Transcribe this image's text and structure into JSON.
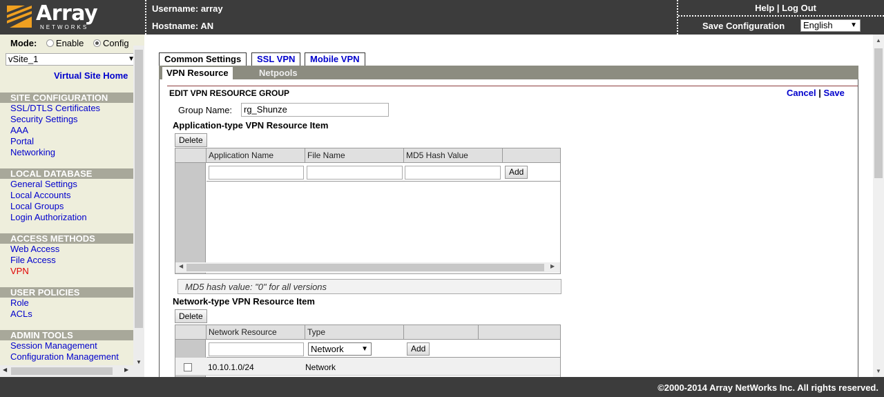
{
  "header": {
    "logo_text": "Array",
    "logo_subtext": "NETWORKS",
    "username_label": "Username:",
    "username": "array",
    "hostname_label": "Hostname:",
    "hostname": "AN",
    "help_label": "Help",
    "separator": "|",
    "logout_label": "Log Out",
    "save_config_label": "Save Configuration",
    "language": "English"
  },
  "sidebar": {
    "mode_label": "Mode:",
    "mode_enable": "Enable",
    "mode_config": "Config",
    "vsite": "vSite_1",
    "vsite_home": "Virtual Site Home",
    "sections": [
      {
        "title": "SITE CONFIGURATION",
        "items": [
          "SSL/DTLS Certificates",
          "Security Settings",
          "AAA",
          "Portal",
          "Networking"
        ]
      },
      {
        "title": "LOCAL DATABASE",
        "items": [
          "General Settings",
          "Local Accounts",
          "Local Groups",
          "Login Authorization"
        ]
      },
      {
        "title": "ACCESS METHODS",
        "items": [
          "Web Access",
          "File Access",
          "VPN"
        ]
      },
      {
        "title": "USER POLICIES",
        "items": [
          "Role",
          "ACLs"
        ]
      },
      {
        "title": "ADMIN TOOLS",
        "items": [
          "Session Management",
          "Configuration Management"
        ]
      }
    ],
    "active_item": "VPN"
  },
  "tabs": {
    "primary": [
      "Common Settings",
      "SSL VPN",
      "Mobile VPN"
    ],
    "secondary": [
      "VPN Resource",
      "Netpools"
    ]
  },
  "edit": {
    "title": "EDIT VPN RESOURCE GROUP",
    "cancel": "Cancel",
    "save": "Save",
    "separator": "|",
    "group_name_label": "Group Name:",
    "group_name_value": "rg_Shunze"
  },
  "app_section": {
    "title": "Application-type VPN Resource Item",
    "delete_label": "Delete",
    "columns": [
      "Application Name",
      "File Name",
      "MD5 Hash Value"
    ],
    "add_label": "Add",
    "note": "MD5 hash value: \"0\" for all versions"
  },
  "net_section": {
    "title": "Network-type VPN Resource Item",
    "delete_label": "Delete",
    "columns": [
      "Network Resource",
      "Type"
    ],
    "type_selected": "Network",
    "add_label": "Add",
    "rows": [
      {
        "resource": "10.10.1.0/24",
        "type": "Network"
      }
    ]
  },
  "footer": {
    "copyright": "©2000-2014 Array NetWorks Inc. All rights reserved."
  },
  "colors": {
    "header_bg": "#3c3c3c",
    "sidebar_bg": "#eeeedc",
    "link": "#0000cc",
    "active_link": "#e00000",
    "logo_orange": "#f0a020"
  }
}
